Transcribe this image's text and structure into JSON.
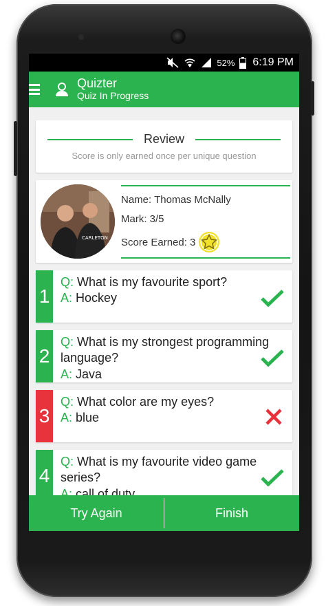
{
  "status_bar": {
    "battery_percent": "52%",
    "time": "6:19 PM",
    "icons": [
      "mute-icon",
      "wifi-icon",
      "signal-icon",
      "battery-icon"
    ]
  },
  "app_bar": {
    "title": "Quizter",
    "subtitle": "Quiz In Progress"
  },
  "review": {
    "title": "Review",
    "note": "Score is only earned once per unique question"
  },
  "profile": {
    "name": "Name: Thomas McNally",
    "mark": "Mark: 3/5",
    "score": "Score Earned: 3"
  },
  "questions": [
    {
      "number": "1",
      "q_label": "Q:",
      "question": "What is my favourite sport?",
      "a_label": "A:",
      "answer": "Hockey",
      "correct": true
    },
    {
      "number": "2",
      "q_label": "Q:",
      "question": "What is my strongest programming language?",
      "a_label": "A:",
      "answer": "Java",
      "correct": true
    },
    {
      "number": "3",
      "q_label": "Q:",
      "question": "What color are my eyes?",
      "a_label": "A:",
      "answer": "blue",
      "correct": false
    },
    {
      "number": "4",
      "q_label": "Q:",
      "question": "What is my favourite video game series?",
      "a_label": "A:",
      "answer": "call of duty",
      "correct": true
    }
  ],
  "bottom_bar": {
    "try_again": "Try Again",
    "finish": "Finish"
  },
  "colors": {
    "accent": "#2ab34e",
    "wrong": "#e8333c",
    "star": "#f2e12a"
  }
}
